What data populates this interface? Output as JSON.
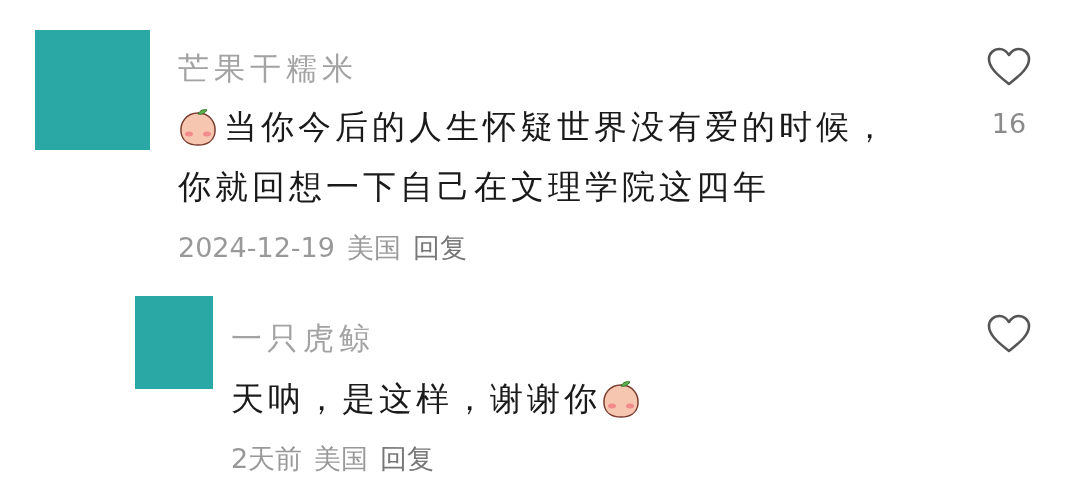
{
  "comments": [
    {
      "author": "芒果干糯米",
      "lines": [
        "当你今后的人生怀疑世界没有爱的时候，",
        "你就回想一下自己在文理学院这四年"
      ],
      "leading_emoji": true,
      "trailing_emoji": false,
      "date": "2024-12-19",
      "location": "美国",
      "reply_label": "回复",
      "likes": "16",
      "children": [
        {
          "author": "一只虎鲸",
          "lines": [
            "天呐，是这样，谢谢你"
          ],
          "leading_emoji": false,
          "trailing_emoji": true,
          "date": "2天前",
          "location": "美国",
          "reply_label": "回复"
        }
      ]
    }
  ]
}
